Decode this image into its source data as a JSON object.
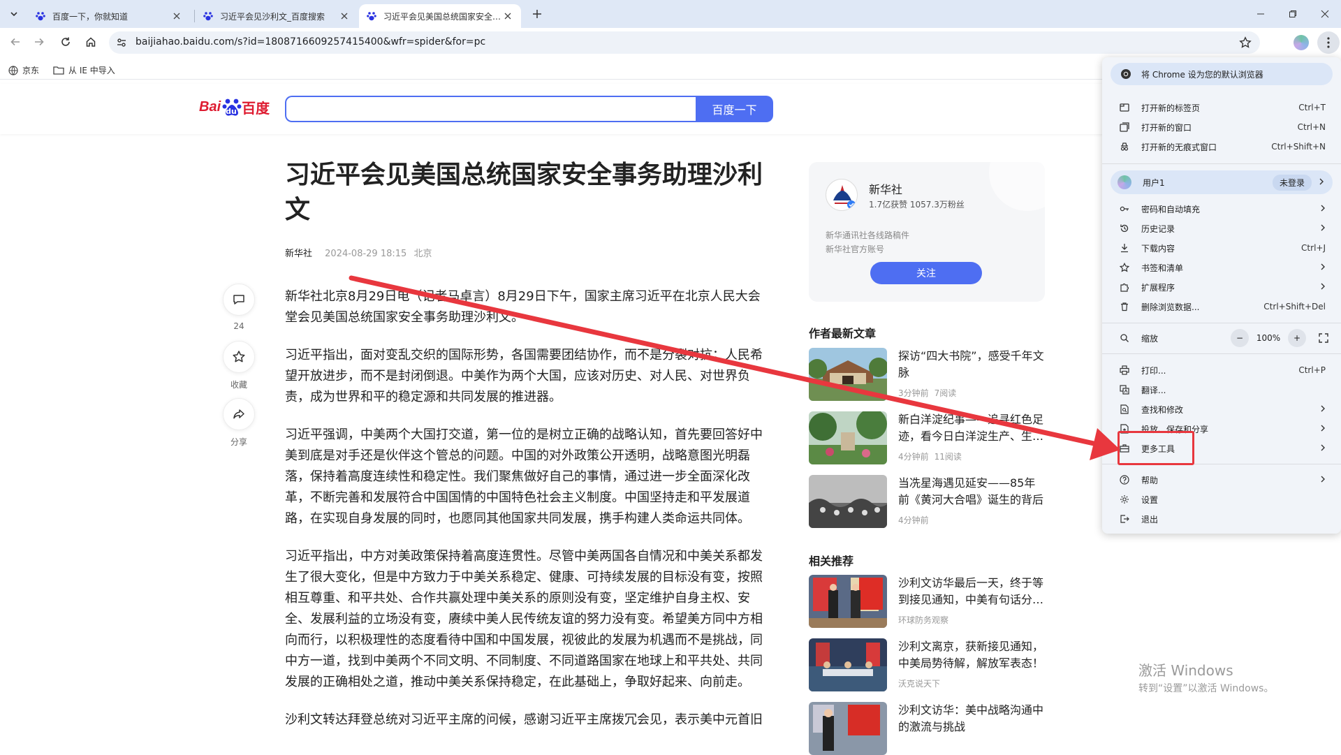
{
  "tabs": [
    {
      "title": "百度一下，你就知道",
      "active": false
    },
    {
      "title": "习近平会见沙利文_百度搜索",
      "active": false
    },
    {
      "title": "习近平会见美国总统国家安全事务助理沙利文",
      "active": true
    }
  ],
  "address_bar": {
    "url": "baijiahao.baidu.com/s?id=1808716609257415400&wfr=spider&for=pc"
  },
  "bookmarks": [
    {
      "label": "京东",
      "icon": "globe-icon"
    },
    {
      "label": "从 IE 中导入",
      "icon": "folder-icon"
    }
  ],
  "baidu": {
    "logo_bai": "Bai",
    "logo_du": "du",
    "logo_cn": "百度",
    "search_button": "百度一下"
  },
  "article": {
    "title": "习近平会见美国总统国家安全事务助理沙利文",
    "source": "新华社",
    "datetime": "2024-08-29 18:15",
    "location": "北京",
    "paragraphs": [
      "新华社北京8月29日电（记者马卓言）8月29日下午，国家主席习近平在北京人民大会堂会见美国总统国家安全事务助理沙利文。",
      "习近平指出，面对变乱交织的国际形势，各国需要团结协作，而不是分裂对抗；人民希望开放进步，而不是封闭倒退。中美作为两个大国，应该对历史、对人民、对世界负责，成为世界和平的稳定源和共同发展的推进器。",
      "习近平强调，中美两个大国打交道，第一位的是树立正确的战略认知，首先要回答好中美到底是对手还是伙伴这个管总的问题。中国的对外政策公开透明，战略意图光明磊落，保持着高度连续性和稳定性。我们聚焦做好自己的事情，通过进一步全面深化改革，不断完善和发展符合中国国情的中国特色社会主义制度。中国坚持走和平发展道路，在实现自身发展的同时，也愿同其他国家共同发展，携手构建人类命运共同体。",
      "习近平指出，中方对美政策保持着高度连贯性。尽管中美两国各自情况和中美关系都发生了很大变化，但是中方致力于中美关系稳定、健康、可持续发展的目标没有变，按照相互尊重、和平共处、合作共赢处理中美关系的原则没有变，坚定维护自身主权、安全、发展利益的立场没有变，赓续中美人民传统友谊的努力没有变。希望美方同中方相向而行，以积极理性的态度看待中国和中国发展，视彼此的发展为机遇而不是挑战，同中方一道，找到中美两个不同文明、不同制度、不同道路国家在地球上和平共处、共同发展的正确相处之道，推动中美关系保持稳定，在此基础上，争取好起来、向前走。",
      "沙利文转达拜登总统对习近平主席的问候，感谢习近平主席拨冗会见，表示美中元首旧"
    ]
  },
  "side_actions": [
    {
      "label": "24",
      "icon": "comment-icon"
    },
    {
      "label": "收藏",
      "icon": "star-icon"
    },
    {
      "label": "分享",
      "icon": "share-icon"
    }
  ],
  "author": {
    "name": "新华社",
    "stats": "1.7亿获赞 1057.3万粉丝",
    "desc1": "新华通讯社各线路稿件",
    "desc2": "新华社官方账号",
    "follow": "关注"
  },
  "latest_section": "作者最新文章",
  "latest": [
    {
      "title": "探访“四大书院”，感受千年文脉",
      "time": "3分钟前",
      "reads": "7阅读"
    },
    {
      "title": "新白洋淀纪事——追寻红色足迹，看今日白洋淀生产、生…",
      "time": "4分钟前",
      "reads": "11阅读"
    },
    {
      "title": "当冼星海遇见延安——85年前《黄河大合唱》诞生的背后",
      "time": "4分钟前",
      "reads": ""
    }
  ],
  "related_section": "相关推荐",
  "related": [
    {
      "title": "沙利文访华最后一天，终于等到接见通知，中美有句话分…",
      "source": "环球防务观察"
    },
    {
      "title": "沙利文离京，获新接见通知，中美局势待解，解放军表态！",
      "source": "沃克说天下"
    },
    {
      "title": "沙利文访华：美中战略沟通中的激流与挑战",
      "source": ""
    }
  ],
  "watermark": {
    "line1": "激活 Windows",
    "line2": "转到“设置”以激活 Windows。"
  },
  "menu": {
    "banner": "将 Chrome 设为您的默认浏览器",
    "group1": [
      {
        "label": "打开新的标签页",
        "shortcut": "Ctrl+T",
        "icon": "new-tab-icon"
      },
      {
        "label": "打开新的窗口",
        "shortcut": "Ctrl+N",
        "icon": "new-window-icon"
      },
      {
        "label": "打开新的无痕式窗口",
        "shortcut": "Ctrl+Shift+N",
        "icon": "incognito-icon"
      }
    ],
    "user": {
      "label": "用户1",
      "badge": "未登录"
    },
    "group2": [
      {
        "label": "密码和自动填充",
        "arrow": true,
        "icon": "key-icon"
      },
      {
        "label": "历史记录",
        "arrow": true,
        "icon": "history-icon"
      },
      {
        "label": "下载内容",
        "shortcut": "Ctrl+J",
        "icon": "download-icon"
      },
      {
        "label": "书签和清单",
        "arrow": true,
        "icon": "bookmark-star-icon"
      },
      {
        "label": "扩展程序",
        "arrow": true,
        "icon": "extension-icon"
      },
      {
        "label": "删除浏览数据...",
        "shortcut": "Ctrl+Shift+Del",
        "icon": "trash-icon"
      }
    ],
    "zoom": {
      "label": "缩放",
      "value": "100%",
      "minus": "−",
      "plus": "+"
    },
    "group3": [
      {
        "label": "打印...",
        "shortcut": "Ctrl+P",
        "icon": "print-icon"
      },
      {
        "label": "翻译...",
        "icon": "translate-icon"
      },
      {
        "label": "查找和修改",
        "arrow": true,
        "icon": "find-icon"
      },
      {
        "label": "投放、保存和分享",
        "arrow": true,
        "icon": "cast-icon"
      },
      {
        "label": "更多工具",
        "arrow": true,
        "icon": "toolbox-icon"
      }
    ],
    "group4": [
      {
        "label": "帮助",
        "arrow": true,
        "icon": "help-icon"
      },
      {
        "label": "设置",
        "icon": "settings-icon"
      },
      {
        "label": "退出",
        "icon": "exit-icon"
      }
    ]
  },
  "colors": {
    "baidu_blue": "#4e6ef2",
    "annotation_red": "#e8373e",
    "menu_bg": "#f1f4f9"
  }
}
